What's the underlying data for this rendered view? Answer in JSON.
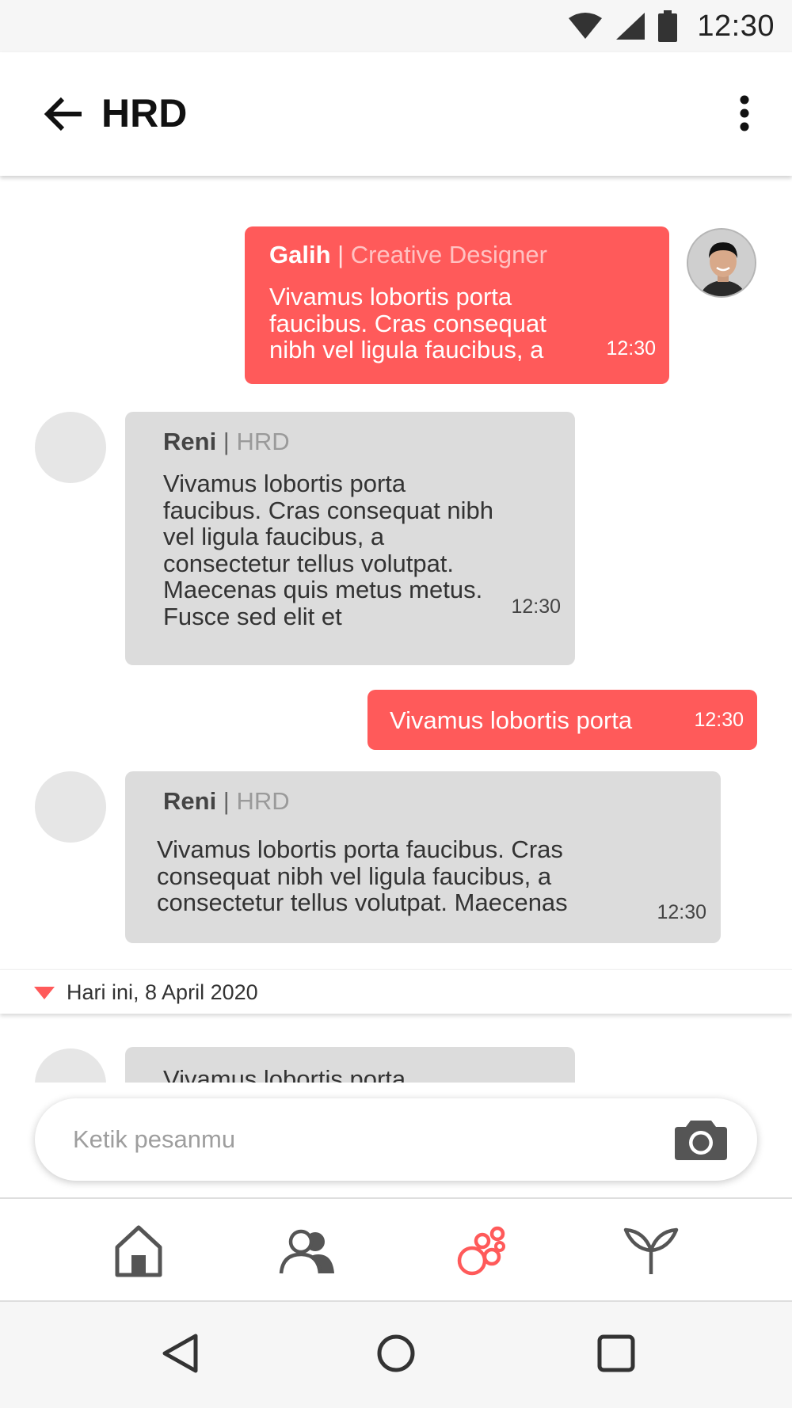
{
  "status_bar": {
    "time": "12:30"
  },
  "app_bar": {
    "title": "HRD"
  },
  "messages": [
    {
      "sender": "Galih",
      "separator": " | ",
      "role": "Creative Designer",
      "text": "Vivamus lobortis porta faucibus. Cras consequat nibh vel ligula faucibus, a",
      "time": "12:30"
    },
    {
      "sender": "Reni",
      "separator": " | ",
      "role": "HRD",
      "text": "Vivamus lobortis porta faucibus. Cras consequat nibh vel ligula faucibus, a consectetur tellus volutpat. Maecenas quis metus metus. Fusce sed elit et",
      "time": "12:30"
    },
    {
      "text": "Vivamus lobortis porta",
      "time": "12:30"
    },
    {
      "sender": "Reni",
      "separator": " | ",
      "role": "HRD",
      "text": "Vivamus lobortis porta faucibus. Cras consequat nibh vel ligula faucibus, a consectetur tellus volutpat. Maecenas",
      "time": "12:30"
    },
    {
      "text": "Vivamus lobortis porta"
    }
  ],
  "date_divider": {
    "label": "Hari ini, 8 April 2020"
  },
  "composer": {
    "placeholder": "Ketik pesanmu"
  },
  "bottom_nav": {
    "items": [
      {
        "icon": "home-icon",
        "active": false
      },
      {
        "icon": "people-icon",
        "active": false
      },
      {
        "icon": "bubbles-icon",
        "active": true
      },
      {
        "icon": "sprout-icon",
        "active": false
      }
    ]
  },
  "colors": {
    "accent": "#ff5a5a",
    "received_bubble": "#dcdcdc",
    "icon_gray": "#555555"
  }
}
